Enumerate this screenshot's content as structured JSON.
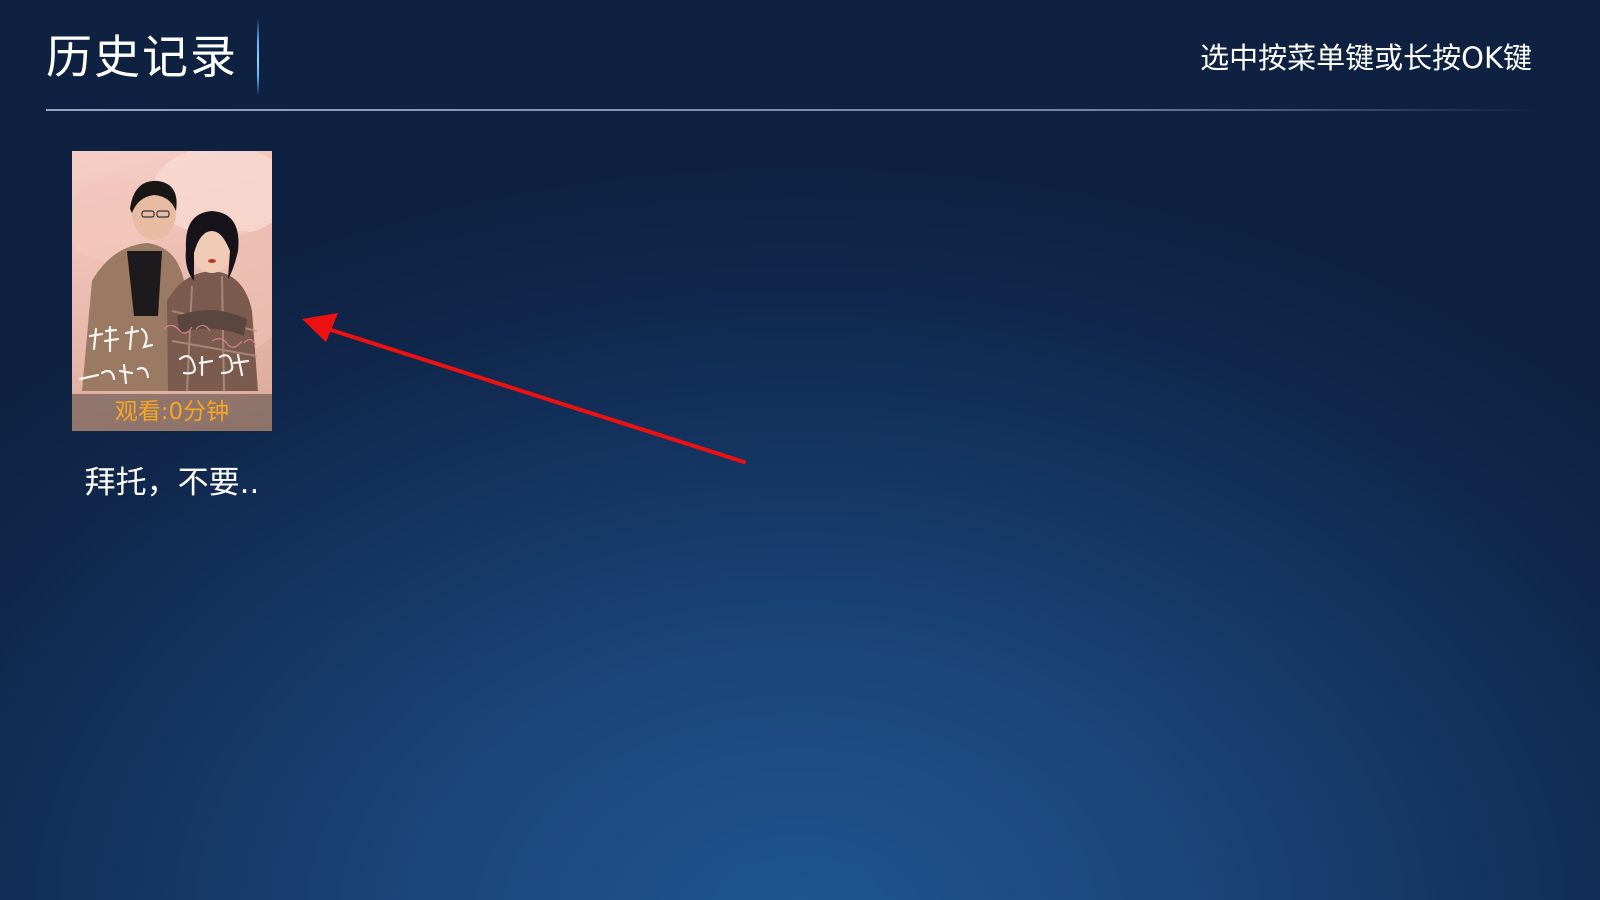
{
  "header": {
    "title": "历史记录",
    "hint": "选中按菜单键或长按OK键"
  },
  "history": {
    "items": [
      {
        "title": "拜托，不要..",
        "watch_label": "观看:0分钟",
        "poster_text": "拜托，不要动我的饭碗"
      }
    ]
  },
  "colors": {
    "watch_label": "#f5a623",
    "annotation_arrow": "#ee1111"
  },
  "icons": {
    "annotation": "red-arrow-icon"
  }
}
